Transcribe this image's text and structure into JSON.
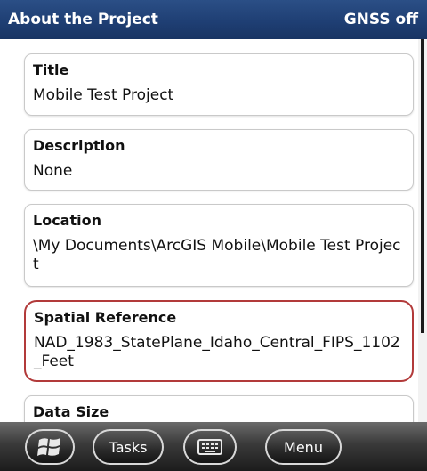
{
  "titlebar": {
    "title": "About the Project",
    "status": "GNSS off"
  },
  "cards": [
    {
      "label": "Title",
      "value": "Mobile Test Project"
    },
    {
      "label": "Description",
      "value": "None"
    },
    {
      "label": "Location",
      "value": "\\My Documents\\ArcGIS Mobile\\Mobile Test Project"
    },
    {
      "label": "Spatial Reference",
      "value": "NAD_1983_StatePlane_Idaho_Central_FIPS_1102_Feet"
    },
    {
      "label": "Data Size",
      "value": ""
    }
  ],
  "taskbar": {
    "start_icon": "windows-logo-icon",
    "tasks_label": "Tasks",
    "keyboard_icon": "keyboard-icon",
    "menu_label": "Menu"
  },
  "colors": {
    "titlebar": "#1f3f74",
    "highlight_border": "#b23a3a",
    "taskbar": "#2a2a2a"
  }
}
